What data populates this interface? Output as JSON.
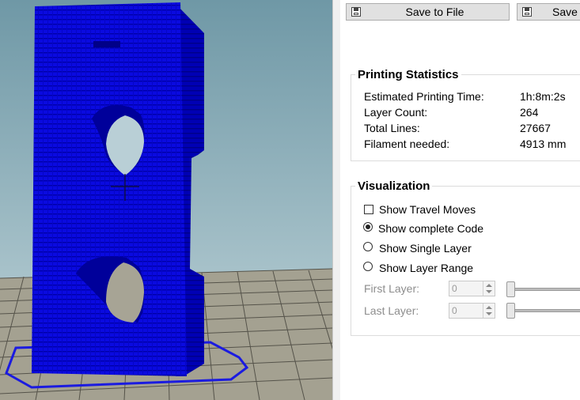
{
  "toolbar": {
    "save_to_file_label": "Save to File",
    "save_second_label": "Save"
  },
  "printing_statistics": {
    "title": "Printing Statistics",
    "rows": [
      {
        "label": "Estimated Printing Time:",
        "value": "1h:8m:2s"
      },
      {
        "label": "Layer Count:",
        "value": "264"
      },
      {
        "label": "Total Lines:",
        "value": "27667"
      },
      {
        "label": "Filament needed:",
        "value": "4913 mm"
      }
    ]
  },
  "visualization": {
    "title": "Visualization",
    "show_travel_moves": {
      "label": "Show Travel Moves",
      "checked": false
    },
    "options": [
      {
        "label": "Show complete Code",
        "selected": true
      },
      {
        "label": "Show Single Layer",
        "selected": false
      },
      {
        "label": "Show Layer Range",
        "selected": false
      }
    ],
    "first_layer": {
      "label": "First Layer:",
      "value": "0"
    },
    "last_layer": {
      "label": "Last Layer:",
      "value": "0"
    }
  },
  "colors": {
    "model_blue": "#0a0adc",
    "sky_top": "#6f98a6",
    "sky_bottom": "#bcd2d8",
    "floor": "#a4a191",
    "grid_line": "#55534a",
    "outline_blue": "#1b1be0"
  },
  "icons": [
    "floppy-disk-icon",
    "crosshair-icon"
  ]
}
